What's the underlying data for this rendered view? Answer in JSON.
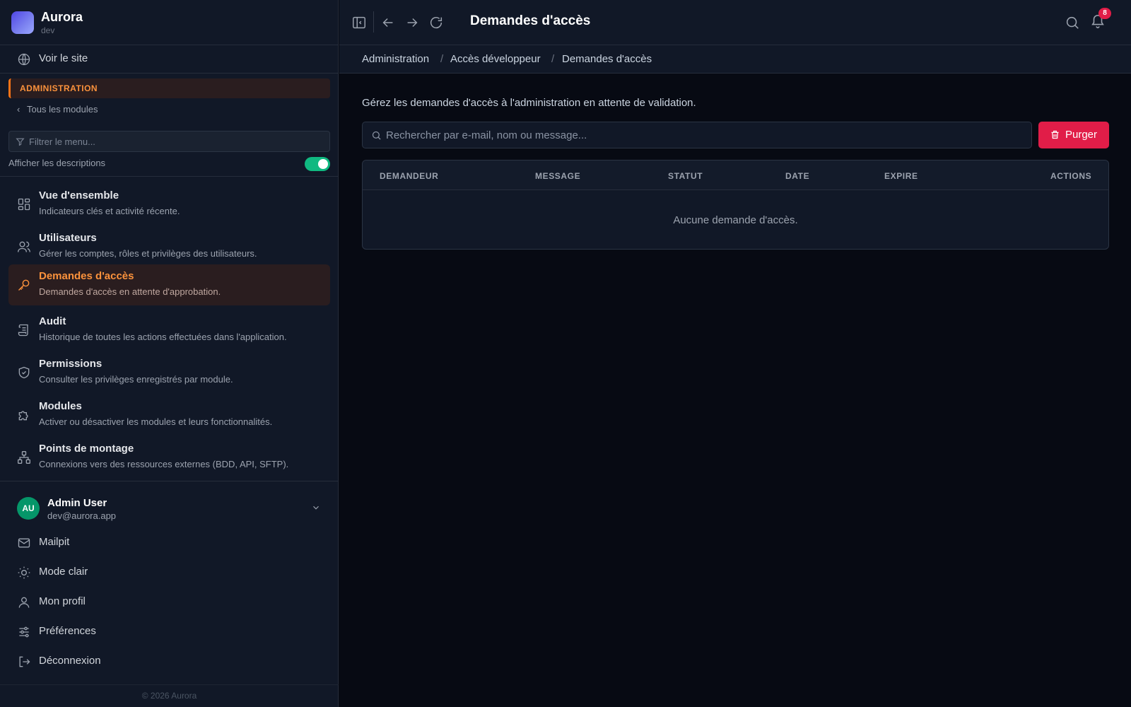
{
  "brand": {
    "name": "Aurora",
    "env": "dev"
  },
  "sidebar": {
    "site_link": "Voir le site",
    "section": "ADMINISTRATION",
    "all_modules": "Tous les modules",
    "filter_placeholder": "Filtrer le menu...",
    "show_descriptions": "Afficher les descriptions",
    "show_descriptions_on": true,
    "items": [
      {
        "title": "Vue d'ensemble",
        "desc": "Indicateurs clés et activité récente.",
        "icon": "dashboard-icon"
      },
      {
        "title": "Utilisateurs",
        "desc": "Gérer les comptes, rôles et privilèges des utilisateurs.",
        "icon": "users-icon"
      },
      {
        "title": "Demandes d'accès",
        "desc": "Demandes d'accès en attente d'approbation.",
        "icon": "key-icon",
        "active": true
      },
      {
        "title": "Audit",
        "desc": "Historique de toutes les actions effectuées dans l'application.",
        "icon": "scroll-icon"
      },
      {
        "title": "Permissions",
        "desc": "Consulter les privilèges enregistrés par module.",
        "icon": "shield-check-icon"
      },
      {
        "title": "Modules",
        "desc": "Activer ou désactiver les modules et leurs fonctionnalités.",
        "icon": "puzzle-icon"
      },
      {
        "title": "Points de montage",
        "desc": "Connexions vers des ressources externes (BDD, API, SFTP).",
        "icon": "network-icon"
      }
    ],
    "user": {
      "initials": "AU",
      "name": "Admin User",
      "email": "dev@aurora.app"
    },
    "bottom_links": [
      {
        "label": "Mailpit",
        "icon": "mail-icon"
      },
      {
        "label": "Mode clair",
        "icon": "sun-icon"
      },
      {
        "label": "Mon profil",
        "icon": "user-icon"
      },
      {
        "label": "Préférences",
        "icon": "sliders-icon"
      },
      {
        "label": "Déconnexion",
        "icon": "logout-icon"
      }
    ],
    "copyright": "© 2026 Aurora"
  },
  "topbar": {
    "title": "Demandes d'accès",
    "notification_count": "8"
  },
  "breadcrumb": [
    "Administration",
    "Accès développeur",
    "Demandes d'accès"
  ],
  "main": {
    "intro": "Gérez les demandes d'accès à l'administration en attente de validation.",
    "search_placeholder": "Rechercher par e-mail, nom ou message...",
    "purge_label": "Purger",
    "columns": [
      "DEMANDEUR",
      "MESSAGE",
      "STATUT",
      "DATE",
      "EXPIRE",
      "ACTIONS"
    ],
    "empty": "Aucune demande d'accès."
  },
  "colors": {
    "accent": "#fb923c",
    "danger": "#e11d48",
    "success": "#10b981",
    "avatar": "#059669"
  }
}
